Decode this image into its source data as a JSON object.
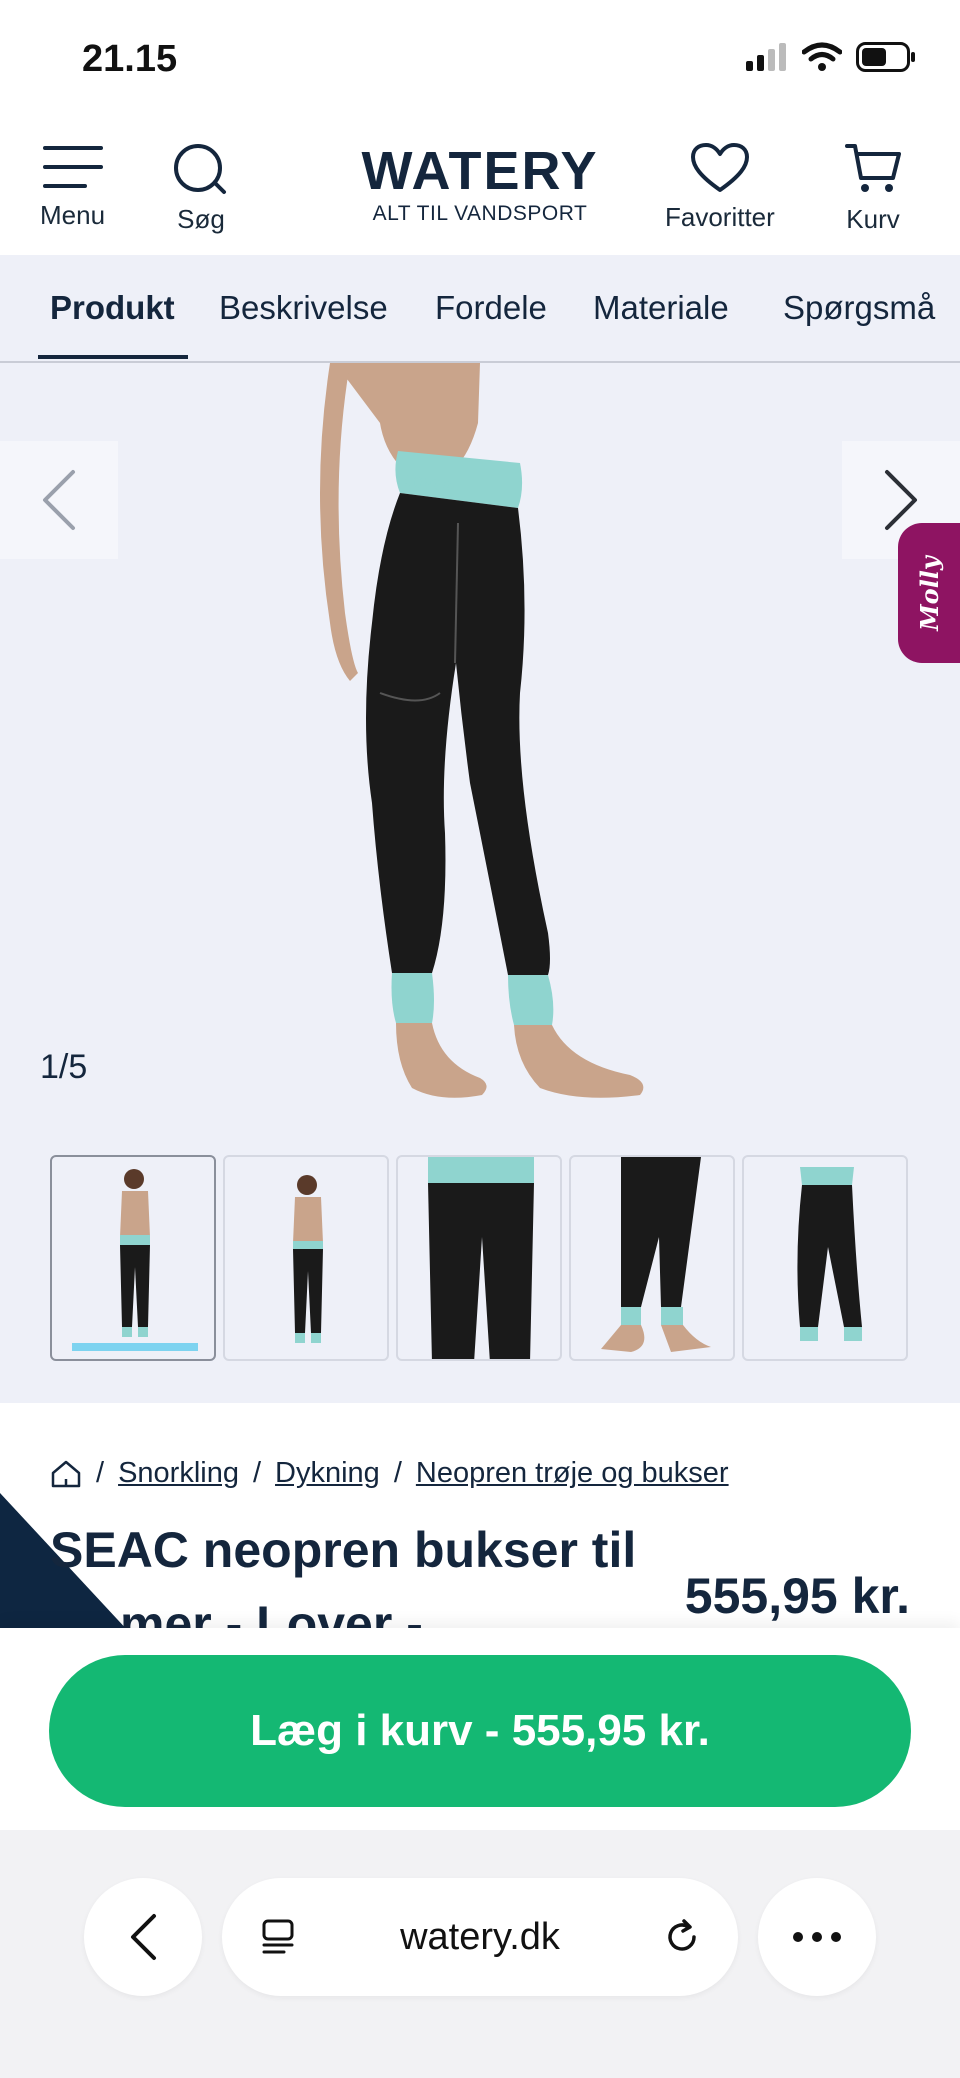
{
  "status_bar": {
    "time": "21.15"
  },
  "header": {
    "menu_label": "Menu",
    "search_label": "Søg",
    "logo_title": "WATERY",
    "logo_subtitle": "ALT TIL VANDSPORT",
    "favorites_label": "Favoritter",
    "cart_label": "Kurv"
  },
  "tabs": [
    {
      "label": "Produkt",
      "active": true
    },
    {
      "label": "Beskrivelse"
    },
    {
      "label": "Fordele"
    },
    {
      "label": "Materiale"
    },
    {
      "label": "Spørgsmå"
    }
  ],
  "gallery": {
    "counter": "1/5",
    "chat_badge": "Molly",
    "thumbnails": 5,
    "active_thumbnail": 1,
    "accent_color": "#8fd4cf"
  },
  "breadcrumb": {
    "items": [
      "Snorkling",
      "Dykning",
      "Neopren trøje og bukser"
    ]
  },
  "product": {
    "title_line1": "SEAC neopren bukser til",
    "title_line2": "mer - Lover -",
    "price": "555,95 kr."
  },
  "cart_button": {
    "label": "Læg i kurv - 555,95 kr.",
    "color": "#14b873"
  },
  "browser": {
    "url": "watery.dk"
  }
}
